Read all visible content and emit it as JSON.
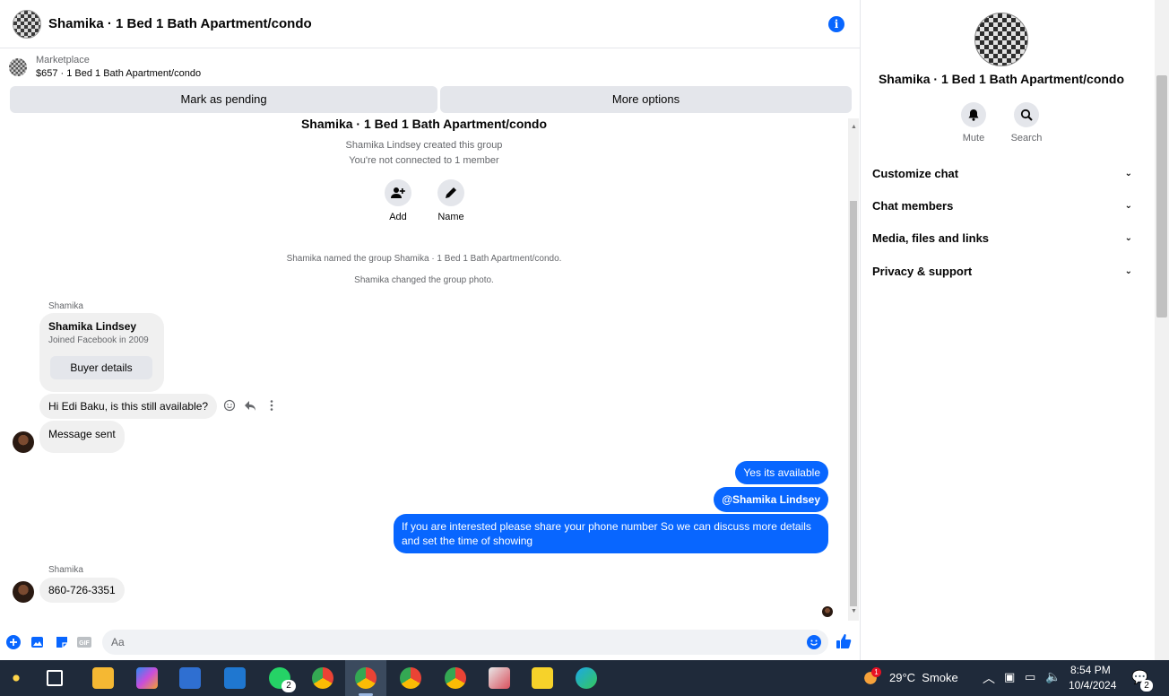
{
  "chat": {
    "title": "Shamika · 1 Bed 1 Bath Apartment/condo",
    "marketplace_label": "Marketplace",
    "listing_line": "$657 · 1 Bed 1 Bath Apartment/condo",
    "mark_pending": "Mark as pending",
    "more_options": "More options",
    "group_title": "Shamika · 1 Bed 1 Bath Apartment/condo",
    "created_line": "Shamika Lindsey created this group",
    "connected_line": "You're not connected to 1 member",
    "add_label": "Add",
    "name_label": "Name",
    "named_event": "Shamika named the group Shamika · 1 Bed 1 Bath Apartment/condo.",
    "photo_event": "Shamika changed the group photo.",
    "sender1": "Shamika",
    "profile_name": "Shamika Lindsey",
    "profile_joined": "Joined Facebook in 2009",
    "buyer_details": "Buyer details",
    "msg1": "Hi Edi Baku, is this still available?",
    "msg2": "Message sent",
    "out1": "Yes its available",
    "out2": "@Shamika Lindsey",
    "out3": "If you are interested please share your phone number So we can discuss more details and set the time of showing",
    "sender2": "Shamika",
    "msg3": "860-726-3351",
    "input_placeholder": "Aa"
  },
  "info": {
    "title": "Shamika · 1 Bed 1 Bath Apartment/condo",
    "mute": "Mute",
    "search": "Search",
    "sections": [
      "Customize chat",
      "Chat members",
      "Media, files and links",
      "Privacy & support"
    ]
  },
  "taskbar": {
    "weather": "29°C  Smoke",
    "time": "8:54 PM",
    "date": "10/4/2024",
    "whatsapp_badge": "2",
    "notif_badge": "2",
    "weather_badge": "1"
  },
  "colors": {
    "accent": "#0866ff",
    "bubble_in": "#f0f0f0",
    "taskbar": "#1f2a3a"
  }
}
